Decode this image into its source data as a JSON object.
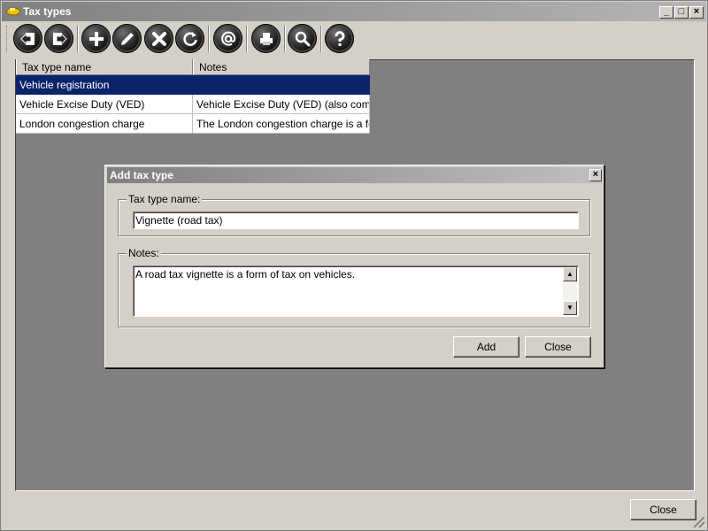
{
  "window": {
    "title": "Tax types",
    "controls": {
      "minimize": "_",
      "maximize": "□",
      "close": "×"
    }
  },
  "toolbar": {
    "buttons": [
      {
        "name": "back-button",
        "icon": "back-arrow-icon"
      },
      {
        "name": "exit-button",
        "icon": "exit-door-icon"
      },
      {
        "name": "add-button",
        "icon": "plus-icon"
      },
      {
        "name": "edit-button",
        "icon": "pencil-icon"
      },
      {
        "name": "delete-button",
        "icon": "cross-icon"
      },
      {
        "name": "refresh-button",
        "icon": "refresh-icon"
      },
      {
        "name": "email-button",
        "icon": "at-sign-icon"
      },
      {
        "name": "print-button",
        "icon": "printer-icon"
      },
      {
        "name": "search-button",
        "icon": "magnifier-icon"
      },
      {
        "name": "help-button",
        "icon": "question-icon"
      }
    ]
  },
  "grid": {
    "columns": [
      "Tax type name",
      "Notes"
    ],
    "rows": [
      {
        "name": "Vehicle registration",
        "notes": "",
        "selected": true
      },
      {
        "name": "Vehicle Excise Duty (VED)",
        "notes": "Vehicle Excise Duty (VED) (also comm...",
        "selected": false
      },
      {
        "name": "London congestion charge",
        "notes": "The London congestion charge is a fe...",
        "selected": false
      }
    ]
  },
  "dialog": {
    "title": "Add tax type",
    "close_glyph": "×",
    "name_group_label": "Tax type name:",
    "name_value": "Vignette (road tax)",
    "notes_group_label": "Notes:",
    "notes_value": "A road tax vignette is a form of tax on vehicles.",
    "scroll_up": "▲",
    "scroll_down": "▼",
    "add_label": "Add",
    "close_label": "Close"
  },
  "footer": {
    "close_label": "Close"
  },
  "colors": {
    "selection": "#0a246a",
    "workspace": "#808080",
    "face": "#d4d0c8"
  }
}
